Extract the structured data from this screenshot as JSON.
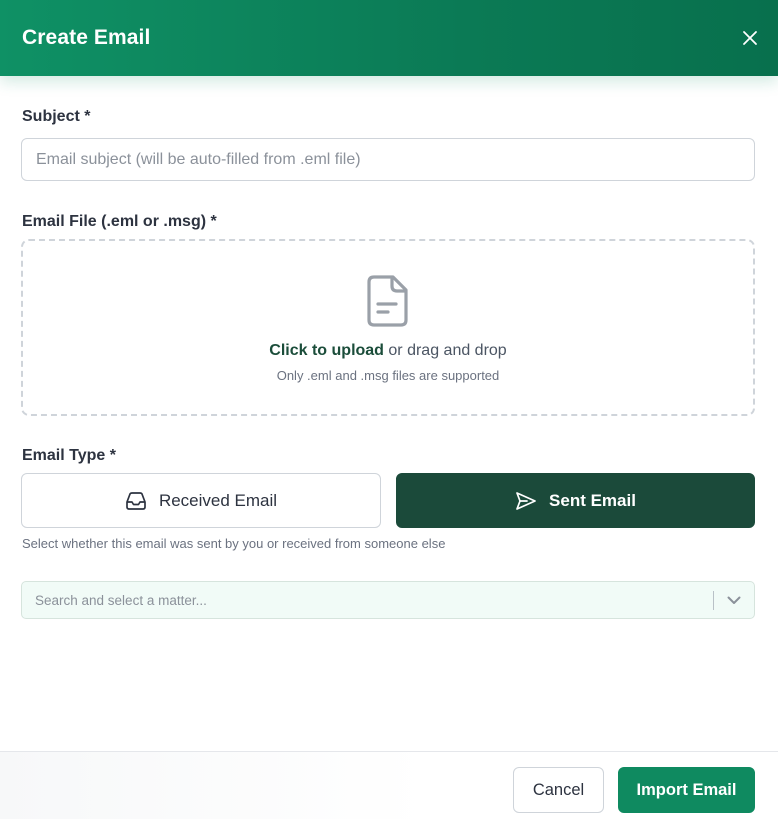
{
  "dialog": {
    "title": "Create Email"
  },
  "subject": {
    "label": "Subject *",
    "placeholder": "Email subject (will be auto-filled from .eml file)",
    "value": ""
  },
  "file": {
    "label": "Email File (.eml or .msg) *",
    "upload_link": "Click to upload",
    "drag_text": " or drag and drop",
    "hint": "Only .eml and .msg files are supported"
  },
  "email_type": {
    "label": "Email Type *",
    "options": [
      "Received Email",
      "Sent Email"
    ],
    "selected": "Sent Email",
    "helper": "Select whether this email was sent by you or received from someone else"
  },
  "matter": {
    "placeholder": "Search and select a matter..."
  },
  "footer": {
    "cancel_label": "Cancel",
    "import_label": "Import Email"
  },
  "colors": {
    "header": "#0f9165",
    "selected_type": "#1b4a3a",
    "primary_button": "#0f8a60",
    "matter_bg": "#f1fbf7"
  },
  "icons": [
    "close-icon",
    "file-icon",
    "inbox-icon",
    "send-icon",
    "chevron-down-icon"
  ]
}
